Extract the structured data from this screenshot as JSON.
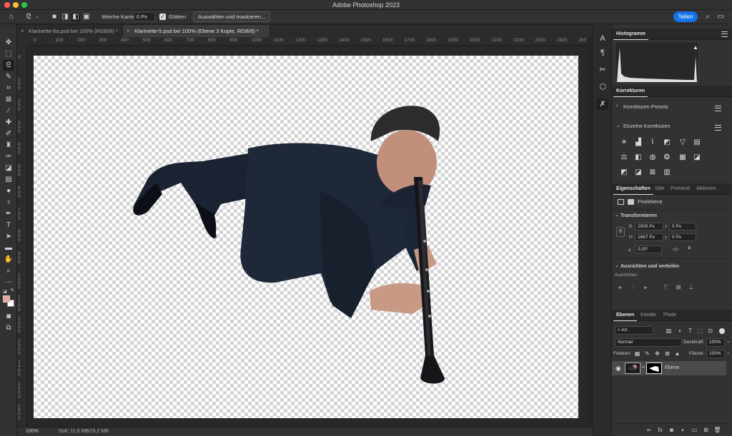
{
  "window": {
    "title": "Adobe Photoshop 2023"
  },
  "colors": {
    "accent": "#1473e6",
    "close": "#ff5f57",
    "minimize": "#febc2e",
    "zoom": "#28c840",
    "foreground": "#e8a899",
    "background": "#ffffff"
  },
  "options_bar": {
    "feather_label": "Weiche Kante:",
    "feather_value": "0 Px",
    "antialias_label": "Glätten",
    "select_mask_label": "Auswählen und maskieren...",
    "share_label": "Teilen"
  },
  "tabs": [
    {
      "label": "Klarinette-6a.psd bei 100% (RGB/8) *"
    },
    {
      "label": "Klarinette-5.psd bei 100% (Ebene 3 Kopie, RGB/8) *"
    }
  ],
  "ruler": {
    "top": [
      "0",
      "50",
      "100",
      "150",
      "200",
      "250",
      "300",
      "350",
      "400",
      "450",
      "500",
      "550",
      "600",
      "650",
      "700",
      "750",
      "800",
      "850",
      "900",
      "950",
      "1000",
      "1050",
      "1100",
      "1150",
      "1200",
      "1250",
      "1300",
      "1350",
      "1400",
      "1450",
      "1500",
      "1550",
      "1600",
      "1650",
      "1700",
      "1750",
      "1800",
      "1850",
      "1900",
      "1950",
      "2000",
      "2050",
      "2100",
      "2150",
      "2200",
      "2250",
      "2300",
      "2350",
      "2400",
      "2450",
      "2500",
      "25"
    ],
    "left": [
      "0",
      "100",
      "200",
      "300",
      "400",
      "500",
      "600",
      "700",
      "800",
      "900",
      "1000",
      "1100",
      "1200",
      "1300",
      "1400",
      "1500",
      "1600"
    ]
  },
  "status": {
    "zoom": "100%",
    "doc_info": "Dok: 11,9 MB/15,2 MB"
  },
  "histogram": {
    "title": "Histogramm"
  },
  "adjustments": {
    "title": "Korrekturen",
    "presets_label": "Korrekturen-Presets",
    "single_label": "Einzelne Korrekturen",
    "icons": [
      "brightness-icon",
      "levels-icon",
      "curves-icon",
      "exposure-icon",
      "vibrance-icon",
      "hue-saturation-icon",
      "color-balance-icon",
      "black-white-icon",
      "photo-filter-icon",
      "channel-mixer-icon",
      "color-lookup-icon",
      "invert-icon",
      "posterize-icon",
      "threshold-icon",
      "selective-color-icon",
      "gradient-map-icon"
    ]
  },
  "properties": {
    "tabs": [
      "Eigenschaften",
      "Stile",
      "Protokoll",
      "Aktionen"
    ],
    "layer_type": "Pixelebene",
    "transform_label": "Transformieren",
    "w_label": "B",
    "w_value": "2500 Px",
    "h_label": "H",
    "h_value": "1667 Px",
    "x_label": "x",
    "x_value": "0 Px",
    "y_label": "y",
    "y_value": "0 Px",
    "angle_value": "0,00°",
    "align_label": "Ausrichten und verteilen",
    "align_sub": "Ausrichten:"
  },
  "layers": {
    "tabs": [
      "Ebenen",
      "Kanäle",
      "Pfade"
    ],
    "filter_kind": "Art",
    "blend_mode": "Normal",
    "opacity_label": "Deckkraft:",
    "opacity_value": "100%",
    "lock_label": "Fixieren:",
    "fill_label": "Fläche:",
    "fill_value": "100%",
    "items": [
      {
        "name": "Ebene"
      }
    ]
  }
}
